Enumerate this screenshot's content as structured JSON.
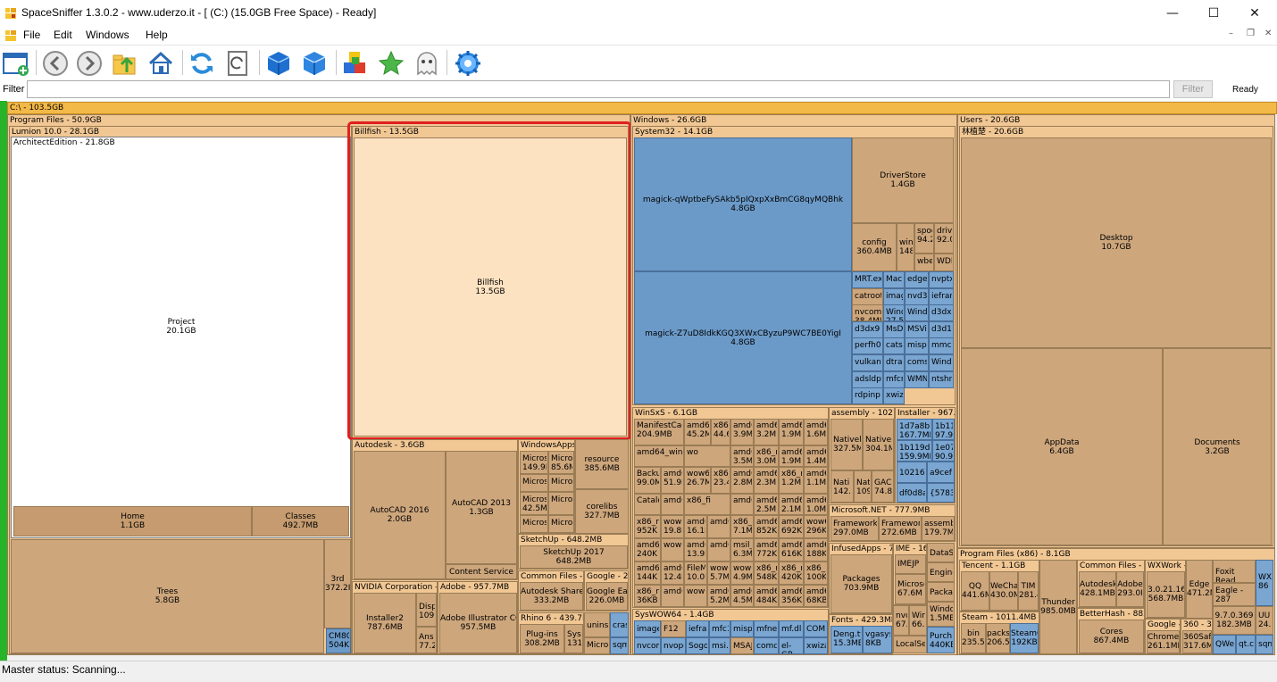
{
  "window": {
    "title": "SpaceSniffer 1.3.0.2 - www.uderzo.it - [ (C:) (15.0GB Free Space) - Ready]"
  },
  "menu": {
    "items": [
      {
        "label": "File"
      },
      {
        "label": "Edit"
      },
      {
        "label": "Windows"
      },
      {
        "label": "Help"
      }
    ]
  },
  "filter": {
    "label": "Filter",
    "value": "",
    "button_label": "Filter",
    "status": "Ready"
  },
  "status": {
    "text": "Master status: Scanning..."
  },
  "map": {
    "root": "C:\\ - 103.5GB",
    "program_files": {
      "header": "Program Files - 50.9GB",
      "lumion": "Lumion 10.0 - 28.1GB",
      "architect": "ArchitectEdition - 21.8GB",
      "project": {
        "name": "Project",
        "size": "20.1GB"
      },
      "home": {
        "name": "Home",
        "size": "1.1GB"
      },
      "classes": {
        "name": "Classes",
        "size": "492.7MB"
      },
      "trees": {
        "name": "Trees",
        "size": "5.8GB"
      },
      "third": {
        "name": "3rd",
        "size": "372.2I"
      },
      "cm80": {
        "name": "CM80",
        "size": "504KE"
      },
      "billfish_hdr": "Billfish - 13.5GB",
      "billfish": {
        "name": "Billfish",
        "size": "13.5GB"
      },
      "autodesk_hdr": "Autodesk - 3.6GB",
      "autocad2016": {
        "name": "AutoCAD 2016",
        "size": "2.0GB"
      },
      "autocad2013": {
        "name": "AutoCAD 2013",
        "size": "1.3GB"
      },
      "content_service": "Content Service",
      "windowsapps_hdr": "WindowsApps",
      "windowsapps_items": [
        "Microsc 149.9M",
        "Micros 85.6M",
        "Micros",
        "Micros",
        "Micros 42.5M",
        "Micros",
        "Micros",
        "Micros"
      ],
      "resource": {
        "name": "resource",
        "size": "385.6MB"
      },
      "corelibs": {
        "name": "corelibs",
        "size": "327.7MB"
      },
      "sketchup_hdr": "SketchUp - 648.2MB",
      "sketchup2017": {
        "name": "SketchUp 2017",
        "size": "648.2MB"
      },
      "common_hdr": "Common Files - 444",
      "autodesk_shared": {
        "name": "Autodesk Share",
        "size": "333.2MB"
      },
      "google_hdr": "Google - 22",
      "google_earth": {
        "name": "Google Ea",
        "size": "226.0MB"
      },
      "nvidia_hdr": "NVIDIA Corporation - 1",
      "installer2": {
        "name": "Installer2",
        "size": "787.6MB"
      },
      "disp": {
        "name": "Disp",
        "size": "109."
      },
      "ans": {
        "name": "Ans",
        "size": "77.2"
      },
      "adobe_hdr": "Adobe - 957.7MB",
      "illustrator": {
        "name": "Adobe Illustrator CC",
        "size": "957.5MB"
      },
      "rhino_hdr": "Rhino 6 - 439.7M",
      "plugins": {
        "name": "Plug-ins",
        "size": "308.2MB"
      },
      "syst": {
        "name": "Syst",
        "size": "131."
      },
      "unins": "unins",
      "cras": "cras",
      "micro": "Micro",
      "sqm": "sqm"
    },
    "windows": {
      "header": "Windows - 26.6GB",
      "system32_hdr": "System32 - 14.1GB",
      "magick1": {
        "name": "magick-qWptbeFySAkb5pIQxpXxBmCG8qyMQBhk",
        "size": "4.8GB"
      },
      "magick2": {
        "name": "magick-Z7uD8IdkKGQ3XWxCByzuP9WC7BE0YigI",
        "size": "4.8GB"
      },
      "driverstore": {
        "name": "DriverStore",
        "size": "1.4GB"
      },
      "config": {
        "name": "config",
        "size": "360.4MB"
      },
      "small_sys": [
        "win 148.",
        "spoo 94.2",
        "drive 92.0",
        "wbe",
        "WDI",
        "MRT.ex",
        "Macr",
        "edgeh",
        "nvptx",
        "catroot2",
        "imag",
        "nvd3d",
        "iefran",
        "nvcom 38.4MI",
        "Windo 27.5M",
        "Windo",
        "d3dx9",
        "d3dx9",
        "MsDtc",
        "MSVic",
        "d3d10",
        "perfh0",
        "catsrv",
        "mispac",
        "mmc.e",
        "vulkan",
        "dtrans",
        "comsv",
        "Windo",
        "adsldp",
        "mfcm1",
        "WMNe",
        "ntshru",
        "rdpinp",
        "xwizar"
      ],
      "winsxs_hdr": "WinSxS - 6.1GB",
      "winsxs_items": [
        "ManifestCach 204.9MB",
        "amd64 45.2M",
        "x86 44.6",
        "amd6 3.9M",
        "amd6 3.2M",
        "amd6 1.9M",
        "amd6 1.6M",
        "amd64_wind",
        "wo",
        "amd6 3.5M",
        "x86_n 3.0M",
        "amd6 1.9M",
        "amd6 1.4M",
        "Backup 99.0M",
        "amd6 51.9I",
        "wow6 26.7M",
        "x86_n 23.4I",
        "amd6 2.8M",
        "amd6 2.3M",
        "x86_n 1.2M",
        "amd6 1.1M",
        "Catalog",
        "amd6",
        "x86_fi",
        "amd6",
        "amd6 2.5M",
        "amd6 2.1M",
        "amd6 1.0M",
        "x86_n 952K",
        "wow6 19.8M",
        "amd6 16.1M",
        "amd6",
        "x86_n 7.1M",
        "amd6 852K",
        "amd6 692K",
        "wow6 296K",
        "amd6 240K",
        "wow6",
        "amd6 13.9M",
        "amd6",
        "msil_s 6.3M",
        "amd6 772K",
        "amd6 616K",
        "amd6 188K",
        "amd6 144K",
        "amd6 12.4M",
        "FileM 10.0M",
        "wow6 5.7M",
        "wow6 4.9M",
        "x86_n 548K",
        "x86_n 420K",
        "x86_n 100K",
        "x86_n 36KB",
        "amd6",
        "wow6",
        "amd6 5.2M",
        "amd6 4.5M",
        "amd6 484K",
        "amd6 356K",
        "amd6 68KB",
        "amd6 4KB"
      ],
      "assembly_hdr": "assembly - 1021.",
      "assembly_items": [
        "Nativel 327.5MI",
        "Nativel 304.1M",
        "Nati 142.1",
        "Nati 109.",
        "GAC 74.8I"
      ],
      "msnet_hdr": "Microsoft.NET - 777.9MB",
      "framework": {
        "name": "Framework",
        "size": "297.0MB"
      },
      "framework64": {
        "name": "Framework",
        "size": "272.6MB"
      },
      "assembly2": {
        "name": "assembl",
        "size": "179.7M"
      },
      "installer_hdr": "Installer - 967.5",
      "installer_items": [
        "1d7a8bb 167.7MB",
        "1b11 97.9I",
        "1b119d7 159.9MB",
        "1e07 90.9I",
        "102168",
        "a9cef",
        "df0d8ac",
        "{5783F"
      ],
      "infused_hdr": "InfusedApps - 72",
      "packages": {
        "name": "Packages",
        "size": "703.9MB"
      },
      "ime_hdr": "IME - 16",
      "ime_items": [
        "IMEJP",
        "Microso 67.6M",
        "nvc 67.",
        "Win 66.",
        "DataS",
        "Engine",
        "Packa",
        "Windo 1.5MB",
        "Purch 440KB",
        "LocalSe"
      ],
      "fonts_hdr": "Fonts - 429.3MB",
      "fonts_items": [
        "Deng.tt 15.3MB",
        "vgasys 8KB"
      ],
      "syswow_hdr": "SysWOW64 - 1.4GB",
      "syswow_items": [
        "image",
        "F12",
        "iefram",
        "mfc1",
        "mispa",
        "mfnet",
        "mf.dll",
        "COM",
        "nvcom",
        "nvope",
        "Sogou",
        "msi.d",
        "MSAJ",
        "comdl",
        "el-GR",
        "xwiza"
      ]
    },
    "users": {
      "header": "Users - 20.6GB",
      "user_hdr": "林植楚 - 20.6GB",
      "desktop": {
        "name": "Desktop",
        "size": "10.7GB"
      },
      "appdata": {
        "name": "AppData",
        "size": "6.4GB"
      },
      "documents": {
        "name": "Documents",
        "size": "3.2GB"
      },
      "pfx86_hdr": "Program Files (x86) - 8.1GB",
      "tencent_hdr": "Tencent - 1.1GB",
      "qq": {
        "name": "QQ",
        "size": "441.6M"
      },
      "wechat": {
        "name": "WeCha",
        "size": "430.0M"
      },
      "tim": {
        "name": "TIM",
        "size": "281.4"
      },
      "thunder": {
        "name": "Thunder",
        "size": "985.0MB"
      },
      "steam_hdr": "Steam - 1011.4MB",
      "bin": {
        "name": "bin",
        "size": "235.5I"
      },
      "packs": {
        "name": "packs",
        "size": "206.5"
      },
      "steamc": {
        "name": "SteamC",
        "size": "192KB"
      },
      "commonf_hdr": "Common Files - 5",
      "autodesk2": {
        "name": "Autodesk",
        "size": "428.1MB"
      },
      "adobe2": {
        "name": "Adobe",
        "size": "293.0I"
      },
      "betterhash_hdr": "BetterHash - 882.",
      "cores": {
        "name": "Cores",
        "size": "867.4MB"
      },
      "wxwork_hdr": "WXWork -",
      "wxwork_ver": {
        "name": "3.0.21.16",
        "size": "568.7MB"
      },
      "edge": {
        "name": "Edge",
        "size": "471.2MB"
      },
      "foxit": "Foxit Read",
      "eagle": "Eagle - 287",
      "wx": {
        "name": "WX",
        "size": "86"
      },
      "ver9": {
        "name": "9.7.0.369",
        "size": "182.3MB"
      },
      "uu": {
        "name": "UU",
        "size": "24."
      },
      "google2_hdr": "Google -",
      "chrome": {
        "name": "Chrome",
        "size": "261.1MB"
      },
      "n360_hdr": "360 - 31",
      "n360safe": {
        "name": "360Saf",
        "size": "317.6M"
      },
      "qwe": "QWe",
      "qtc": "qt.c",
      "sqm2": "sqm"
    }
  }
}
